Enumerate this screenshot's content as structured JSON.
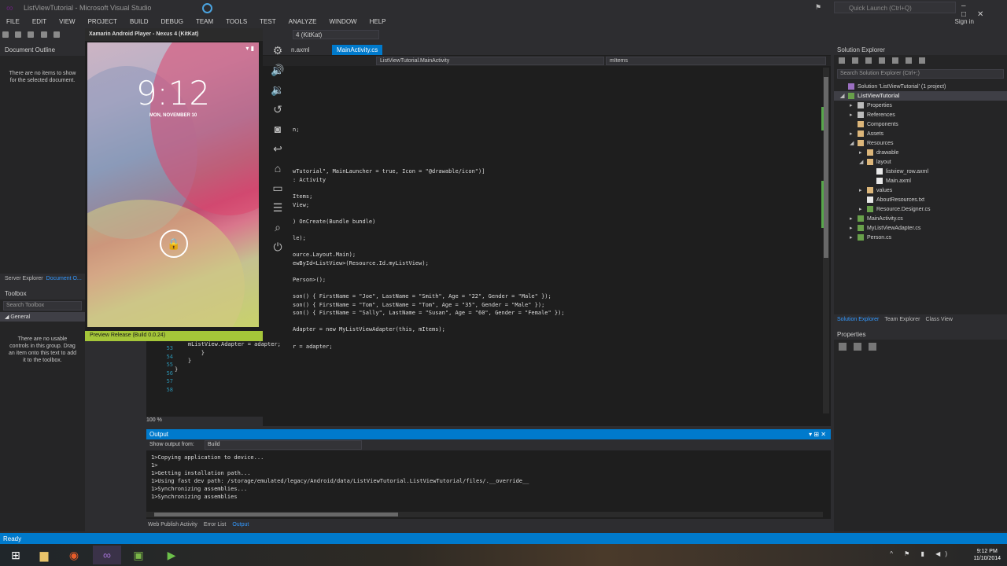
{
  "window": {
    "title": "ListViewTutorial - Microsoft Visual Studio",
    "quick_launch": "Quick Launch (Ctrl+Q)",
    "sign_in": "Sign in"
  },
  "menu": [
    "FILE",
    "EDIT",
    "VIEW",
    "PROJECT",
    "BUILD",
    "DEBUG",
    "TEAM",
    "TOOLS",
    "TEST",
    "ANALYZE",
    "WINDOW",
    "HELP"
  ],
  "toolbar": {
    "device_combo": "4 (KitKat)"
  },
  "doc_outline": {
    "title": "Document Outline",
    "message": "There are no items to show for the selected document."
  },
  "left_tabs": {
    "server_explorer": "Server Explorer",
    "document_outline": "Document O..."
  },
  "toolbox": {
    "title": "Toolbox",
    "search": "Search Toolbox",
    "group": "General",
    "message": "There are no usable controls in this group. Drag an item onto this text to add it to the toolbox."
  },
  "emulator": {
    "title": "Xamarin Android Player - Nexus 4 (KitKat)",
    "time": "9:12",
    "date": "MON, NOVEMBER 10",
    "preview": "Preview Release (Build 0.0.24)"
  },
  "editor": {
    "tabs": [
      {
        "label": "n.axml"
      },
      {
        "label": "MainActivity.cs"
      }
    ],
    "nav_class": "ListViewTutorial.MainActivity",
    "nav_member": "mItems",
    "zoom": "100 %",
    "code_lines": [
      "",
      "",
      "",
      "",
      "",
      "",
      "",
      "n;",
      "",
      "",
      "",
      "",
      "wTutorial\", MainLauncher = true, Icon = \"@drawable/icon\")]",
      ": Activity",
      "",
      "Items;",
      "View;",
      "",
      ") OnCreate(Bundle bundle)",
      "",
      "le);",
      "",
      "ource.Layout.Main);",
      "ewById<ListView>(Resource.Id.myListView);",
      "",
      "Person>();",
      "",
      "son() { FirstName = \"Joe\", LastName = \"Smith\", Age = \"22\", Gender = \"Male\" });",
      "son() { FirstName = \"Tom\", LastName = \"Tom\", Age = \"35\", Gender = \"Male\" });",
      "son() { FirstName = \"Sally\", LastName = \"Susan\", Age = \"60\", Gender = \"Female\" });",
      "",
      "Adapter = new MyListViewAdapter(this, mItems);",
      "",
      "r = adapter;"
    ],
    "left_lines": [
      "    mListView.Adapter = adapter;",
      "        }",
      "    }",
      "}",
      "",
      ""
    ],
    "line_numbers": "53\n54\n55\n56\n57\n58"
  },
  "output": {
    "title": "Output",
    "show_from_label": "Show output from:",
    "show_from_value": "Build",
    "lines": [
      "1>Copying application to device...",
      "1>",
      "1>Getting installation path...",
      "1>Using fast dev path: /storage/emulated/legacy/Android/data/ListViewTutorial.ListViewTutorial/files/.__override__",
      "1>Synchronizing assemblies...",
      "1>Synchronizing assemblies"
    ]
  },
  "bottom_tabs": [
    "Web Publish Activity",
    "Error List",
    "Output"
  ],
  "solution_explorer": {
    "title": "Solution Explorer",
    "search": "Search Solution Explorer (Ctrl+;)",
    "items": [
      {
        "label": "Solution 'ListViewTutorial' (1 project)",
        "icon": "sol",
        "depth": 0,
        "arrow": ""
      },
      {
        "label": "ListViewTutorial",
        "icon": "cs",
        "depth": 0,
        "arrow": "◢",
        "selected": true
      },
      {
        "label": "Properties",
        "icon": "ref",
        "depth": 1,
        "arrow": "▸"
      },
      {
        "label": "References",
        "icon": "ref",
        "depth": 1,
        "arrow": "▸"
      },
      {
        "label": "Components",
        "icon": "folder",
        "depth": 1,
        "arrow": ""
      },
      {
        "label": "Assets",
        "icon": "folder",
        "depth": 1,
        "arrow": "▸"
      },
      {
        "label": "Resources",
        "icon": "folder",
        "depth": 1,
        "arrow": "◢"
      },
      {
        "label": "drawable",
        "icon": "folder",
        "depth": 2,
        "arrow": "▸"
      },
      {
        "label": "layout",
        "icon": "folder",
        "depth": 2,
        "arrow": "◢"
      },
      {
        "label": "listview_row.axml",
        "icon": "file",
        "depth": 3,
        "arrow": ""
      },
      {
        "label": "Main.axml",
        "icon": "file",
        "depth": 3,
        "arrow": ""
      },
      {
        "label": "values",
        "icon": "folder",
        "depth": 2,
        "arrow": "▸"
      },
      {
        "label": "AboutResources.txt",
        "icon": "file",
        "depth": 2,
        "arrow": ""
      },
      {
        "label": "Resource.Designer.cs",
        "icon": "cs",
        "depth": 2,
        "arrow": "▸"
      },
      {
        "label": "MainActivity.cs",
        "icon": "cs",
        "depth": 1,
        "arrow": "▸"
      },
      {
        "label": "MyListViewAdapter.cs",
        "icon": "cs",
        "depth": 1,
        "arrow": "▸"
      },
      {
        "label": "Person.cs",
        "icon": "cs",
        "depth": 1,
        "arrow": "▸"
      }
    ],
    "tabs": [
      "Solution Explorer",
      "Team Explorer",
      "Class View"
    ]
  },
  "properties": {
    "title": "Properties"
  },
  "status": {
    "text": "Ready"
  },
  "taskbar": {
    "time": "9:12 PM",
    "date": "11/10/2014"
  }
}
